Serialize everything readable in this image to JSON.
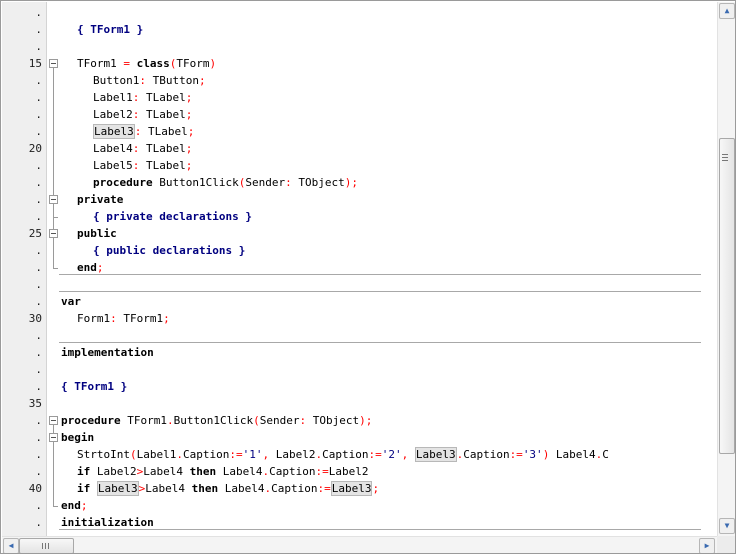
{
  "gutter": [
    ".",
    ".",
    ".",
    "15",
    ".",
    ".",
    ".",
    ".",
    "20",
    ".",
    ".",
    ".",
    ".",
    "25",
    ".",
    ".",
    ".",
    ".",
    "30",
    ".",
    ".",
    ".",
    ".",
    "35",
    ".",
    ".",
    ".",
    ".",
    "40",
    ".",
    "."
  ],
  "code": {
    "l2": [
      "{ TForm1 }"
    ],
    "l4": [
      "TForm1",
      " = ",
      "class",
      "(",
      "TForm",
      ")"
    ],
    "l5": [
      "Button1",
      ": ",
      "TButton",
      ";"
    ],
    "l6": [
      "Label1",
      ": ",
      "TLabel",
      ";"
    ],
    "l7": [
      "Label2",
      ": ",
      "TLabel",
      ";"
    ],
    "l8": [
      "Label3",
      ": ",
      "TLabel",
      ";"
    ],
    "l9": [
      "Label4",
      ": ",
      "TLabel",
      ";"
    ],
    "l10": [
      "Label5",
      ": ",
      "TLabel",
      ";"
    ],
    "l11": [
      "procedure",
      " Button1Click",
      "(",
      "Sender",
      ": ",
      "TObject",
      ")",
      ";"
    ],
    "l12": [
      "private"
    ],
    "l13": [
      "{ private declarations }"
    ],
    "l14": [
      "public"
    ],
    "l15": [
      "{ public declarations }"
    ],
    "l16": [
      "end",
      ";"
    ],
    "l18": [
      "var"
    ],
    "l19": [
      "Form1",
      ": ",
      "TForm1",
      ";"
    ],
    "l21": [
      "implementation"
    ],
    "l23": [
      "{ TForm1 }"
    ],
    "l25": [
      "procedure",
      " TForm1",
      ".",
      "Button1Click",
      "(",
      "Sender",
      ": ",
      "TObject",
      ")",
      ";"
    ],
    "l26": [
      "begin"
    ],
    "l27": [
      "StrtoInt",
      "(",
      "Label1",
      ".",
      "Caption",
      ":=",
      "'1'",
      ", ",
      "Label2",
      ".",
      "Caption",
      ":=",
      "'2'",
      ", ",
      "Label3",
      ".",
      "Caption",
      ":=",
      "'3'",
      ")",
      " Label4",
      ".",
      "C"
    ],
    "l28": [
      "if",
      " Label2",
      ">",
      "Label4",
      " then",
      " Label4",
      ".",
      "Caption",
      ":=",
      "Label2"
    ],
    "l29": [
      "if",
      " ",
      "Label3",
      ">",
      "Label4",
      " then",
      " Label4",
      ".",
      "Caption",
      ":=",
      "Label3",
      ";"
    ],
    "l30": [
      "end",
      ";"
    ],
    "l31": [
      "initialization"
    ]
  },
  "scrollbar": {
    "up_arrow": "▲",
    "down_arrow": "▼",
    "left_arrow": "◀",
    "right_arrow": "▶"
  }
}
